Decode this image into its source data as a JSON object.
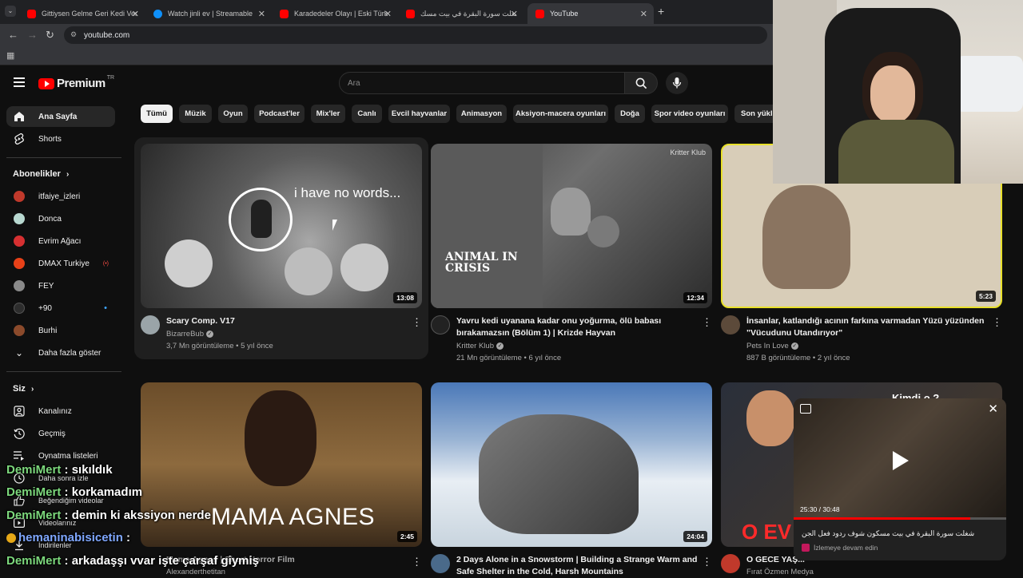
{
  "tabs": [
    {
      "title": "Gittiysen Gelme Geri Kedi Versi",
      "color": "#ff0000"
    },
    {
      "title": "Watch jinli ev | Streamable",
      "color": "#0f90fa"
    },
    {
      "title": "Karadedeler Olayı | Eski Türk Fi",
      "color": "#ff0000"
    },
    {
      "title": "شغلت سورة البقرة في بيت مسك",
      "color": "#ff0000"
    },
    {
      "title": "YouTube",
      "color": "#ff0000"
    }
  ],
  "address": {
    "url": "youtube.com"
  },
  "header": {
    "logo_text": "Premium",
    "logo_badge": "TR",
    "search_placeholder": "Ara"
  },
  "sidebar": {
    "main": [
      {
        "label": "Ana Sayfa",
        "icon": "home-icon"
      },
      {
        "label": "Shorts",
        "icon": "shorts-icon"
      }
    ],
    "subs_title": "Abonelikler",
    "subs": [
      {
        "label": "itfaiye_izleri",
        "color": "#c0392b"
      },
      {
        "label": "Donca",
        "color": "#b8d8d0"
      },
      {
        "label": "Evrim Ağacı",
        "color": "#d63031"
      },
      {
        "label": "DMAX Turkiye",
        "color": "#e84118",
        "badge": "(•)"
      },
      {
        "label": "FEY",
        "color": "#8a8a8a"
      },
      {
        "label": "+90",
        "color": "#2d2d2d",
        "badge": "•"
      },
      {
        "label": "Burhi",
        "color": "#8b4a2b"
      }
    ],
    "show_more": "Daha fazla göster",
    "you_title": "Siz",
    "you_items": [
      {
        "label": "Kanalınız",
        "icon": "account-icon"
      },
      {
        "label": "Geçmiş",
        "icon": "history-icon"
      },
      {
        "label": "Oynatma listeleri",
        "icon": "playlist-icon"
      },
      {
        "label": "Daha sonra izle",
        "icon": "clock-icon"
      },
      {
        "label": "Beğendiğim videolar",
        "icon": "like-icon"
      },
      {
        "label": "Videolarınız",
        "icon": "video-icon"
      },
      {
        "label": "İndirilenler",
        "icon": "download-icon"
      }
    ]
  },
  "chips": [
    "Tümü",
    "Müzik",
    "Oyun",
    "Podcast'ler",
    "Mix'ler",
    "Canlı",
    "Evcil hayvanlar",
    "Animasyon",
    "Aksiyon-macera oyunları",
    "Doğa",
    "Spor video oyunları",
    "Son yükle"
  ],
  "videos": [
    {
      "title1": "Scary Comp. V17",
      "title2": "",
      "channel": "BizarreBub",
      "meta": "3,7 Mn görüntüleme • 5 yıl önce",
      "duration": "13:08",
      "overlay": "i have no words...",
      "channel_color": "#9aa4a8"
    },
    {
      "title1": "Yavru kedi uyanana kadar onu yoğurma, ölü babası",
      "title2": "bırakamazsın (Bölüm 1) | Krizde Hayvan",
      "channel": "Kritter Klub",
      "meta": "21 Mn görüntüleme • 6 yıl önce",
      "duration": "12:34",
      "overlay": "ANIMAL IN CRISIS",
      "overlay_small": "Kritter Klub",
      "channel_color": "#222222"
    },
    {
      "title1": "İnsanlar, katlandığı acının farkına varmadan Yüzü yüzünden",
      "title2": "\"Vücudunu Utandırıyor\"",
      "channel": "Pets In Love",
      "meta": "887 B görüntüleme • 2 yıl önce",
      "duration": "5:23",
      "channel_color": "#5c4a3a"
    },
    {
      "title1": "Mama Agnes | Short Horror Film",
      "title2": "",
      "channel": "Alexanderthetitan",
      "meta": "",
      "duration": "2:45",
      "overlay": "MAMA AGNES",
      "channel_color": "#6a5a4a"
    },
    {
      "title1": "2 Days Alone in a Snowstorm | Building a Strange Warm and",
      "title2": "Safe Shelter in the Cold, Harsh Mountains",
      "channel": "",
      "meta": "",
      "duration": "24:04",
      "channel_color": "#4a6a8a"
    },
    {
      "title1": "O GECE YAŞ...",
      "title2": "",
      "channel": "Fırat Özmen Medya",
      "meta": "",
      "duration": "",
      "overlay": "O EV",
      "overlay_top": "Kimdi o ?",
      "channel_color": "#c0392b"
    }
  ],
  "miniplayer": {
    "time": "25:30 / 30:48",
    "title": "شغلت سورة البقرة في بيت مسكون شوف ردود فعل الجن",
    "subtitle": "İzlemeye devam edin",
    "progress": 0.83
  },
  "chat": [
    {
      "user": "DemiMert",
      "msg": ": sıkıldık"
    },
    {
      "user": "DemiMert",
      "msg": ": korkamadım"
    },
    {
      "user": "DemiMert",
      "msg": ": demin ki akssiyon nerde"
    },
    {
      "user": "hemaninabisicetin",
      "msg": ":"
    },
    {
      "user": "DemiMert",
      "msg": ": arkadaşşı vvar işte çarşaf giymiş"
    }
  ],
  "colors": {
    "bg": "#0f0f0f",
    "chip": "#272727",
    "accent": "#ff0000",
    "muted": "#aaaaaa"
  }
}
